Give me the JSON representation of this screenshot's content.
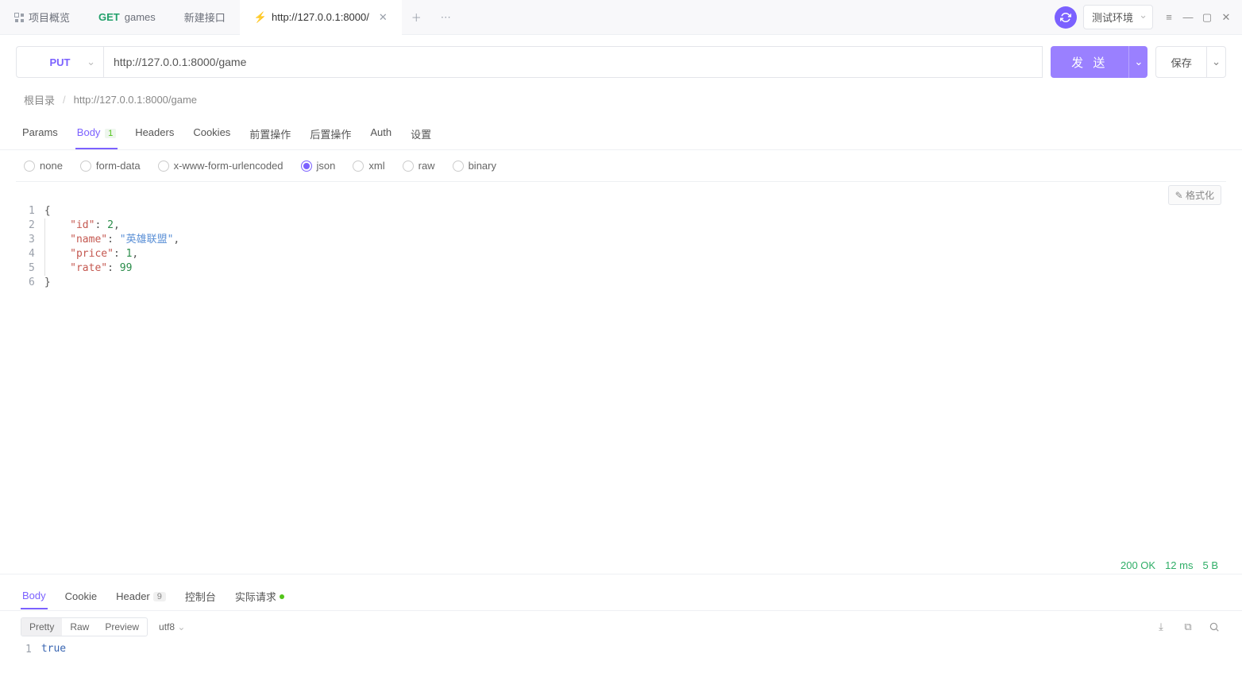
{
  "tabs": {
    "overview": "项目概览",
    "get_method": "GET",
    "get_name": "games",
    "new_api": "新建接口",
    "active_url": "http://127.0.0.1:8000/"
  },
  "toolbar": {
    "env": "测试环境"
  },
  "request": {
    "method": "PUT",
    "url": "http://127.0.0.1:8000/game",
    "send": "发 送",
    "save": "保存"
  },
  "breadcrumb": {
    "root": "根目录",
    "path": "http://127.0.0.1:8000/game"
  },
  "req_tabs": {
    "params": "Params",
    "body": "Body",
    "body_badge": "1",
    "headers": "Headers",
    "cookies": "Cookies",
    "pre": "前置操作",
    "post": "后置操作",
    "auth": "Auth",
    "settings": "设置"
  },
  "body_types": {
    "none": "none",
    "form": "form-data",
    "xform": "x-www-form-urlencoded",
    "json": "json",
    "xml": "xml",
    "raw": "raw",
    "binary": "binary"
  },
  "editor": {
    "format_btn": "格式化",
    "lines": [
      "1",
      "2",
      "3",
      "4",
      "5",
      "6"
    ],
    "json": {
      "id_key": "\"id\"",
      "id_val": "2",
      "name_key": "\"name\"",
      "name_val": "\"英雄联盟\"",
      "price_key": "\"price\"",
      "price_val": "1",
      "rate_key": "\"rate\"",
      "rate_val": "99"
    }
  },
  "resp_tabs": {
    "body": "Body",
    "cookie": "Cookie",
    "header": "Header",
    "header_badge": "9",
    "console": "控制台",
    "actual": "实际请求"
  },
  "resp_format": {
    "pretty": "Pretty",
    "raw": "Raw",
    "preview": "Preview",
    "encoding": "utf8"
  },
  "response": {
    "line_no": "1",
    "value": "true"
  },
  "status": {
    "code": "200 OK",
    "time": "12 ms",
    "size": "5 B"
  }
}
